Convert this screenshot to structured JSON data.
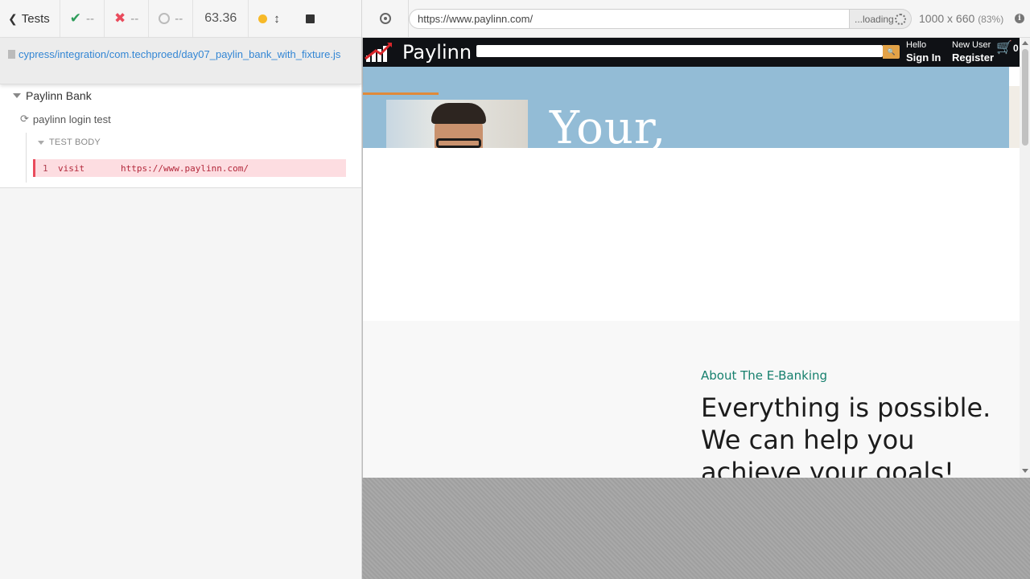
{
  "reporter": {
    "tests_label": "Tests",
    "passed": "--",
    "failed": "--",
    "pending": "--",
    "duration": "63.36",
    "spec_path": "cypress/integration/com.techproed/day07_paylin_bank_with_fixture.js",
    "suite_title": "Paylinn Bank",
    "test_title": "paylinn login test",
    "test_body_label": "TEST BODY",
    "command": {
      "number": "1",
      "name": "visit",
      "message": "https://www.paylinn.com/"
    }
  },
  "aut": {
    "url": "https://www.paylinn.com/",
    "loading_text": "...loading",
    "viewport": "1000 x 660",
    "scale": "(83%)"
  },
  "site": {
    "brand": "Paylinn",
    "hello": "Hello",
    "sign_in": "Sign In",
    "new_user": "New User",
    "register": "Register",
    "cart_count": "0",
    "hero_text": "Your,",
    "about_kicker": "About The E-Banking",
    "about_title": "Everything is possible. We can help you achieve your goals!"
  },
  "colors": {
    "pass": "#2e9c5a",
    "fail": "#e94b5c",
    "running": "#f7b928",
    "link": "#3386d4",
    "hero_bg": "#93bcd6",
    "accent_teal": "#17806e"
  }
}
